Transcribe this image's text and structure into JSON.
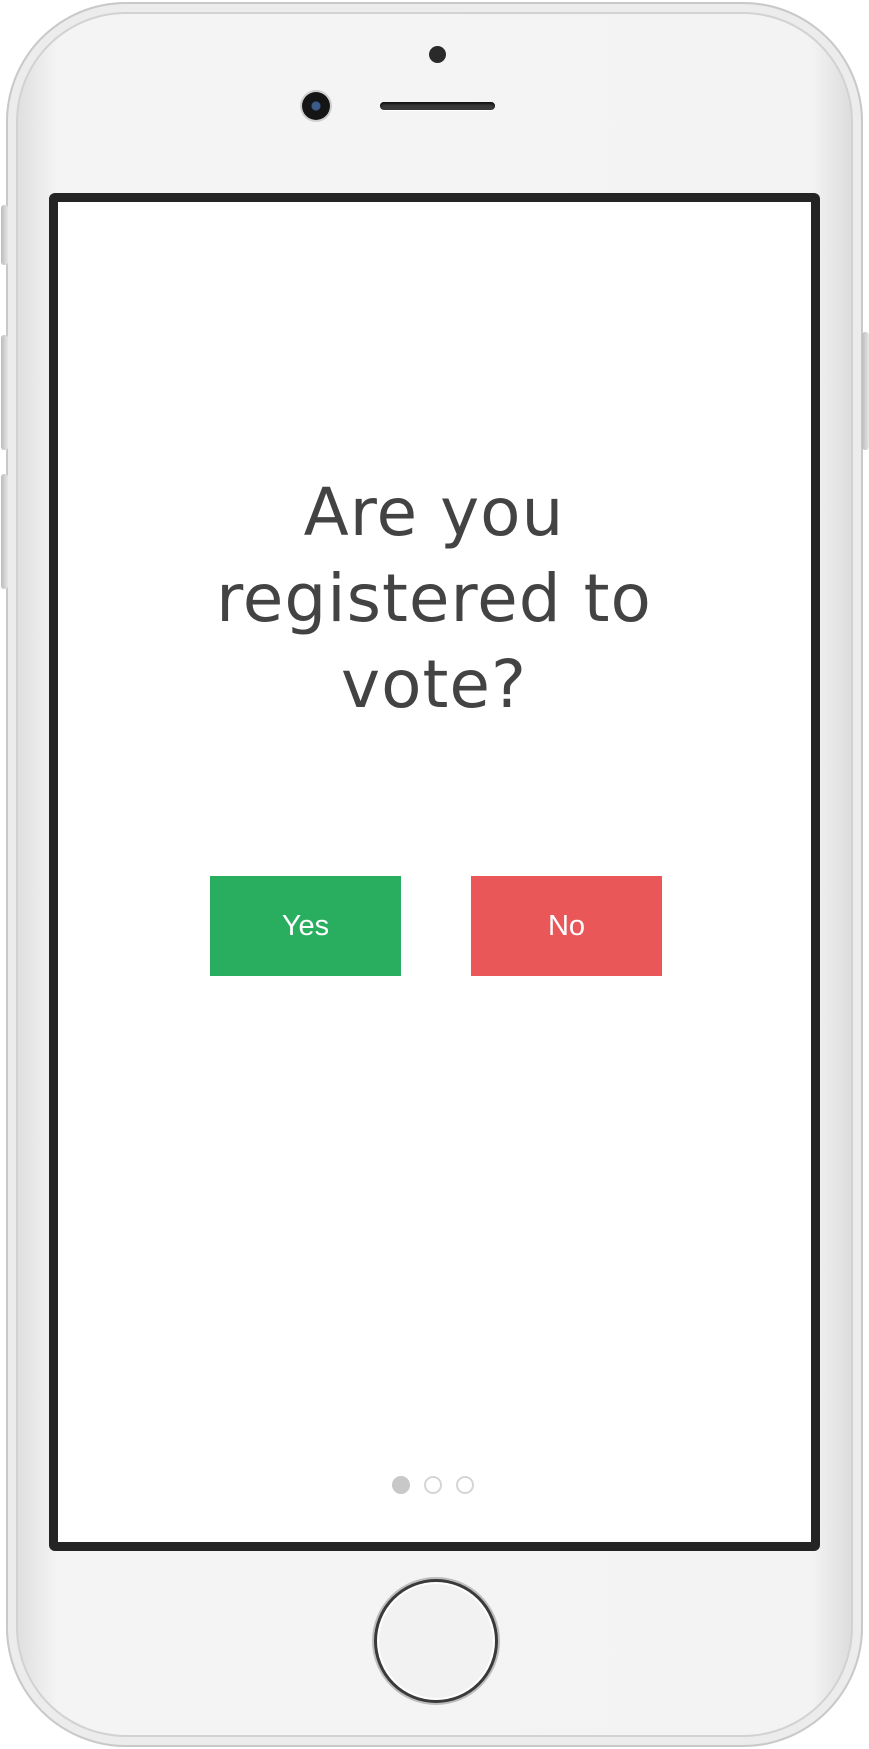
{
  "screen": {
    "question": "Are you registered to vote?",
    "yes_label": "Yes",
    "no_label": "No",
    "pagination": {
      "total": 3,
      "active_index": 0
    }
  },
  "colors": {
    "yes_button": "#29ae60",
    "no_button": "#ea5759",
    "question_text": "#434343",
    "dot_active": "#c8c8c8",
    "dot_inactive_border": "#d5d5d5"
  },
  "device": {
    "icons": [
      "front-camera-icon",
      "earpiece-speaker-icon",
      "proximity-sensor-icon",
      "home-button-icon"
    ]
  }
}
